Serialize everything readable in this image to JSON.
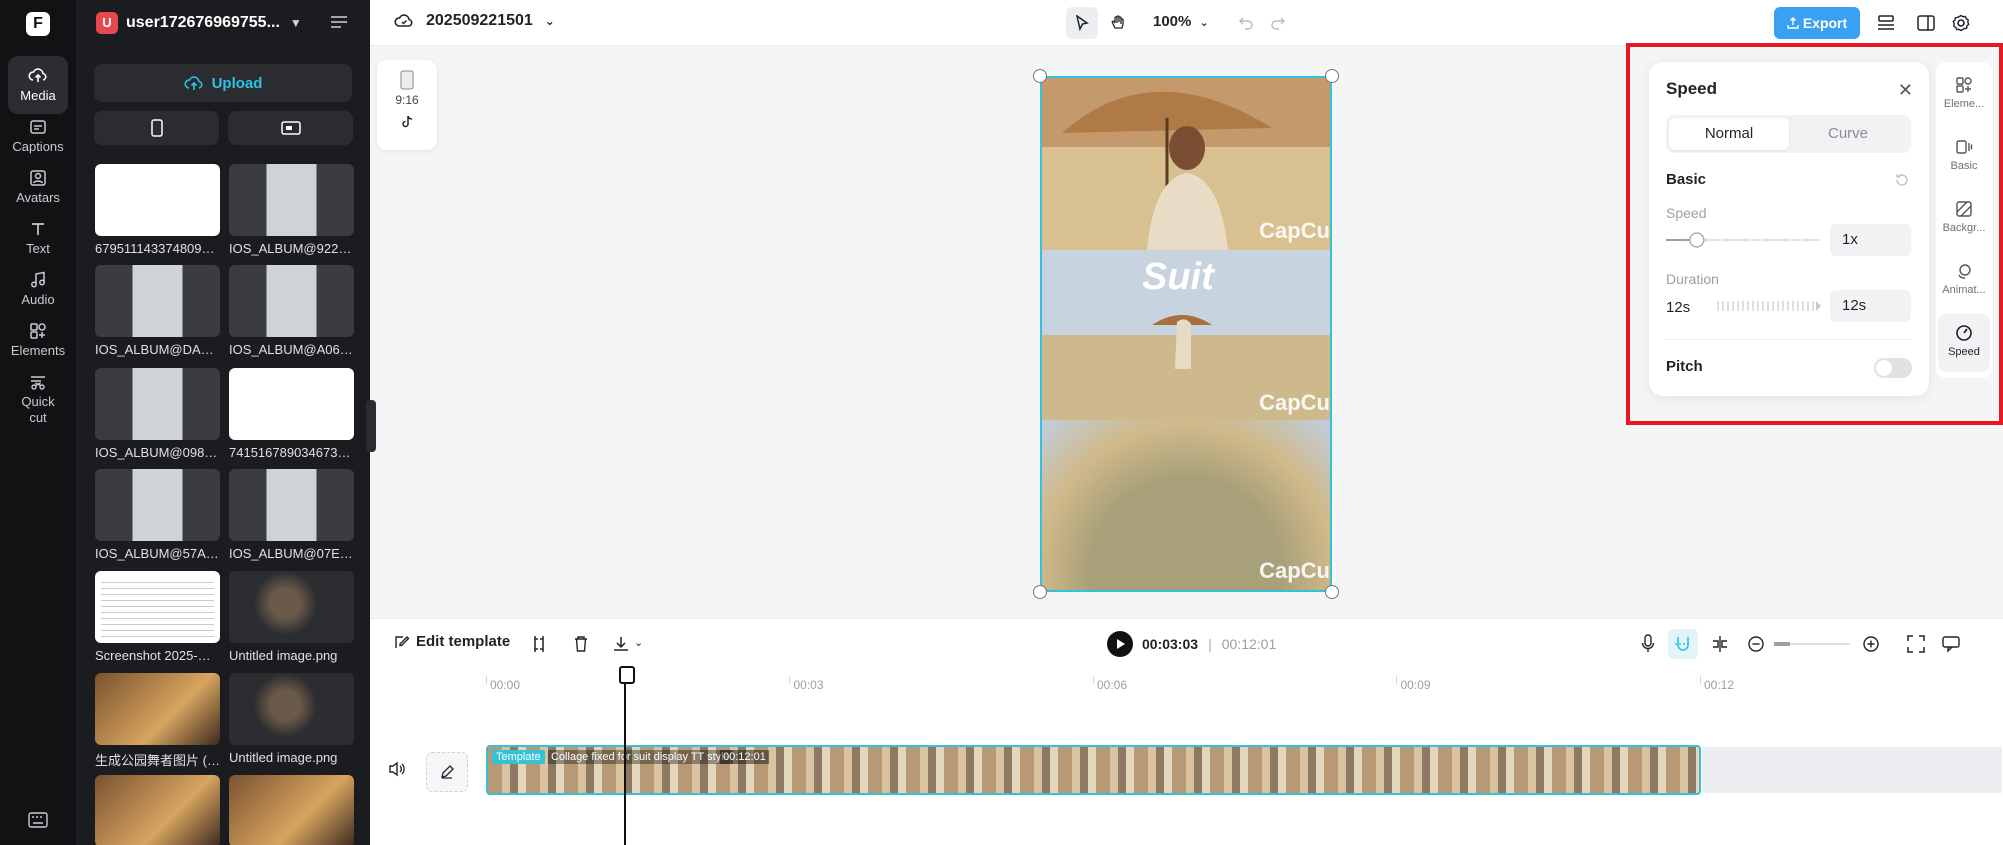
{
  "app": {
    "logo_letter": "F"
  },
  "rail": {
    "items": [
      {
        "label": "Media",
        "icon": "cloud-upload-icon"
      },
      {
        "label": "Captions",
        "icon": "captions-icon"
      },
      {
        "label": "Avatars",
        "icon": "avatar-icon"
      },
      {
        "label": "Text",
        "icon": "text-icon"
      },
      {
        "label": "Audio",
        "icon": "music-note-icon"
      },
      {
        "label": "Elements",
        "icon": "elements-icon"
      },
      {
        "label": "Quick cut",
        "icon": "scissors-icon"
      }
    ]
  },
  "media_panel": {
    "user_initial": "U",
    "username": "user172676969755...",
    "upload_label": "Upload",
    "items": [
      {
        "caption": "679511143374809…",
        "kind": "white"
      },
      {
        "caption": "IOS_ALBUM@9227…",
        "kind": "room"
      },
      {
        "caption": "IOS_ALBUM@DAA…",
        "kind": "room"
      },
      {
        "caption": "IOS_ALBUM@A061…",
        "kind": "room"
      },
      {
        "caption": "IOS_ALBUM@098…",
        "kind": "room"
      },
      {
        "caption": "741516789034673…",
        "kind": "white"
      },
      {
        "caption": "IOS_ALBUM@57A…",
        "kind": "room"
      },
      {
        "caption": "IOS_ALBUM@07E…",
        "kind": "room"
      },
      {
        "caption": "Screenshot 2025-…",
        "kind": "doc"
      },
      {
        "caption": "Untitled image.png",
        "kind": "dark"
      },
      {
        "caption": "生成公园舞者图片 (…",
        "kind": "warm"
      },
      {
        "caption": "Untitled image.png",
        "kind": "dark"
      },
      {
        "caption": "",
        "kind": "warm"
      },
      {
        "caption": "",
        "kind": "warm"
      }
    ]
  },
  "topbar": {
    "project_name": "202509221501",
    "zoom": "100%",
    "export_label": "Export"
  },
  "canvas": {
    "ratio_label": "9:16",
    "overlay_text": "Suit",
    "watermark": "CapCu"
  },
  "speed_panel": {
    "title": "Speed",
    "tabs": [
      "Normal",
      "Curve"
    ],
    "active_tab": "Normal",
    "basic_label": "Basic",
    "speed_label": "Speed",
    "speed_value": "1x",
    "speed_slider_position": 0.2,
    "duration_label": "Duration",
    "duration_left": "12s",
    "duration_value": "12s",
    "pitch_label": "Pitch",
    "pitch_on": false
  },
  "right_tabs": [
    {
      "label": "Eleme...",
      "icon": "elements-icon"
    },
    {
      "label": "Basic",
      "icon": "basic-icon"
    },
    {
      "label": "Backgr...",
      "icon": "background-icon"
    },
    {
      "label": "Animat...",
      "icon": "animation-icon"
    },
    {
      "label": "Speed",
      "icon": "speed-icon"
    }
  ],
  "timeline": {
    "edit_template_label": "Edit template",
    "current_time": "00:03:03",
    "separator": "|",
    "total_time": "00:12:01",
    "ticks": [
      "00:00",
      "00:03",
      "00:06",
      "00:09",
      "00:12"
    ],
    "clip_badge": "Template",
    "clip_title": "Collage fixed for suit display TT style",
    "clip_duration": "00:12:01"
  }
}
